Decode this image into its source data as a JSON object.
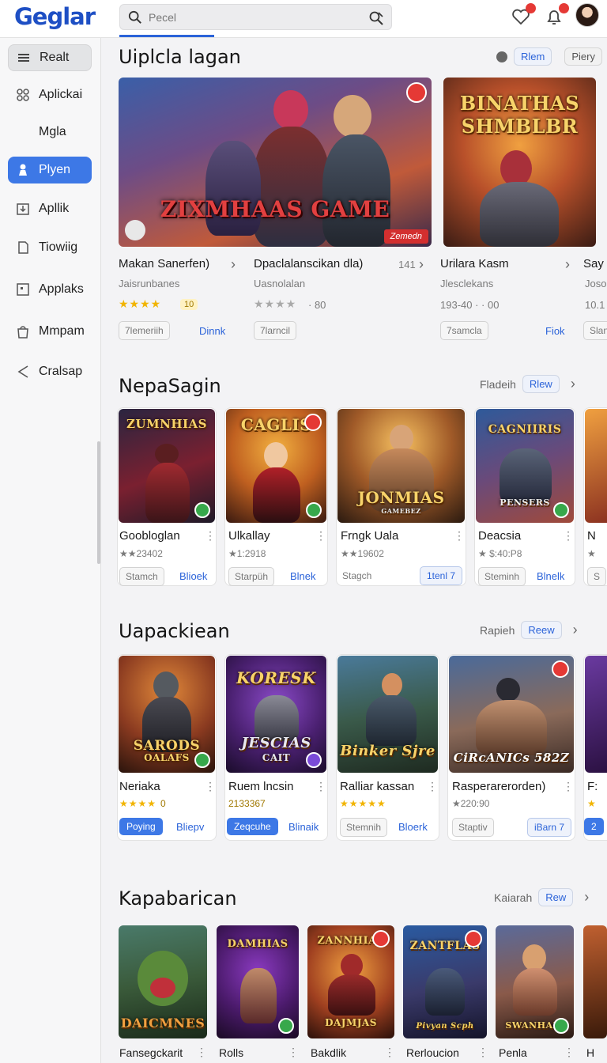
{
  "header": {
    "logo": "Geglar",
    "search_placeholder": "Pecel"
  },
  "sidebar": {
    "items": [
      {
        "label": "Realt",
        "icon": "menu-icon",
        "state": "muted"
      },
      {
        "label": "Aplickai",
        "icon": "apps-icon",
        "state": ""
      },
      {
        "label": "Mgla",
        "icon": "",
        "state": ""
      },
      {
        "label": "Plyen",
        "icon": "pawn-icon",
        "state": "active"
      },
      {
        "label": "Apllik",
        "icon": "download-icon",
        "state": ""
      },
      {
        "label": "Tiowiig",
        "icon": "doc-icon",
        "state": ""
      },
      {
        "label": "Applaks",
        "icon": "square-icon",
        "state": ""
      },
      {
        "label": "Mmpam",
        "icon": "bag-icon",
        "state": ""
      },
      {
        "label": "Cralsap",
        "icon": "share-icon",
        "state": ""
      }
    ]
  },
  "featured": {
    "title": "Uiplcla lagan",
    "chip1": "Rlem",
    "chip2": "Piery",
    "cards": [
      {
        "art": "ZIXMHAAS GAME",
        "label": "Zemedn",
        "title": "Makan Sanerfen)",
        "sub": "Jaisrunbanes",
        "stars": "★★★★",
        "rating": "10",
        "btn": "7lemeriih",
        "link": "Dinnk"
      },
      {
        "title": "Dpaclalanscikan dla)",
        "meta": "141",
        "sub": "Uasnolalan",
        "stars": "★★★★",
        "rating_text": "· 80",
        "btn": "7larncil"
      },
      {
        "art": "BINATHAS SHMBLBR",
        "title": "Urilara Kasm",
        "sub": "Jlesclekans",
        "rating_text": "193-40 · · 00",
        "btn": "7samcla",
        "link": "Fiok"
      },
      {
        "title": "Say",
        "sub": "Joso",
        "rating_text": "10.1",
        "btn": "Slan"
      }
    ]
  },
  "section2": {
    "title": "NepaSagin",
    "ctrl_text": "Fladeih",
    "chip": "Rlew",
    "cards": [
      {
        "art": "ZUMNHIAS",
        "title": "Goobloglan",
        "sub": "★★23402",
        "btn": "Stamch",
        "link": "Blioek"
      },
      {
        "art": "CAGLIS",
        "title": "Ulkallay",
        "sub": "★1:2918",
        "btn": "Starpüh",
        "link": "Blnek"
      },
      {
        "art": "JONMIAS",
        "art2": "GAMEBEZ",
        "title": "Frngk Uala",
        "sub": "★★19602",
        "btn": "Stagch",
        "btn2": "1tenl 7"
      },
      {
        "art": "CAGNIIRIS",
        "art2": "PENSERS",
        "title": "Deacsia",
        "sub": "★ $:40:P8",
        "btn": "Steminh",
        "link": "Blnelk"
      },
      {
        "title": "N",
        "sub": "★",
        "btn": "S"
      }
    ]
  },
  "section3": {
    "title": "Uapackiean",
    "ctrl_text": "Rapieh",
    "chip": "Reew",
    "cards": [
      {
        "art": "SARODS",
        "art2": "OALAFS",
        "title": "Neriaka",
        "stars": "★★★★",
        "rating_text": "0",
        "btn_blue": "Poying",
        "link": "Bliepv"
      },
      {
        "art": "KORESK",
        "art2": "JESCIAS",
        "art3": "CAIT",
        "title": "Ruem lncsin",
        "sub": "2133367",
        "btn_blue": "Zeqcuhe",
        "link": "Blinaik"
      },
      {
        "art": "Binker Sjre",
        "title": "Ralliar kassan",
        "stars": "★★★★★",
        "btn": "Stemnih",
        "link": "Bloerk"
      },
      {
        "art": "CiRcANICs 582Z",
        "title": "Rasperarerorden)",
        "sub": "★220:90",
        "btn": "Staptiv",
        "btn2": "iBarn 7"
      },
      {
        "title": "F:",
        "stars": "★",
        "btn_blue": "2"
      }
    ]
  },
  "section4": {
    "title": "Kapabarican",
    "ctrl_text": "Kaiarah",
    "chip": "Rew",
    "cards": [
      {
        "art": "DAICMNES",
        "title": "Fansegckarit"
      },
      {
        "art": "DAMHIAS",
        "title": "Rolls"
      },
      {
        "art": "ZANNHIAS",
        "art2": "DAJMJAS",
        "title": "Bakdlik"
      },
      {
        "art": "ZANTFLAS",
        "art2": "Pivyan Scph",
        "title": "Rerloucion"
      },
      {
        "art": "SWANHAIS",
        "title": "Penla"
      },
      {
        "title": "H"
      }
    ]
  },
  "colors": {
    "accent": "#3d78e6",
    "brand": "#1e4fc4",
    "badge_red": "#e53935",
    "badge_green": "#37a84b"
  }
}
